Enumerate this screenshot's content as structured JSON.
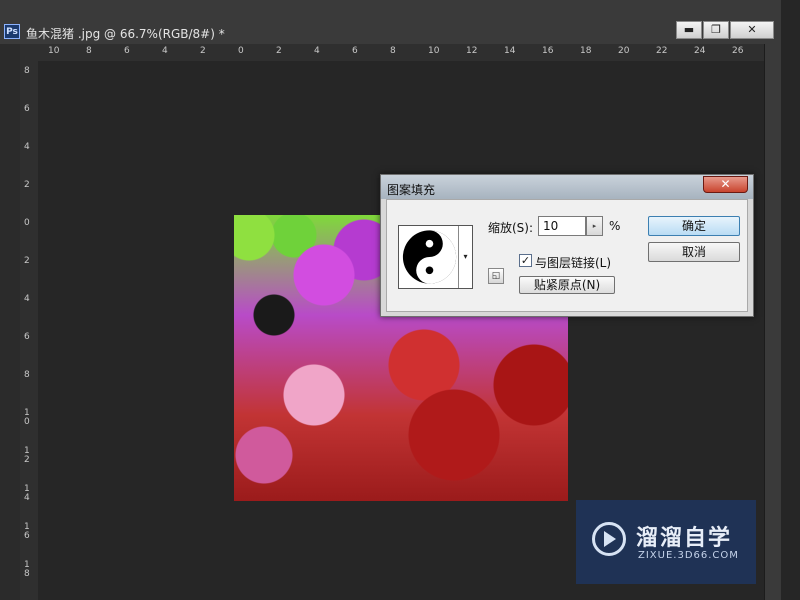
{
  "document": {
    "app_icon_label": "Ps",
    "title": "鱼木混猪 .jpg @ 66.7%(RGB/8#) *",
    "window_buttons": [
      "▬",
      "❐",
      "✕"
    ]
  },
  "rulers": {
    "top": [
      "10",
      "8",
      "6",
      "4",
      "2",
      "0",
      "2",
      "4",
      "6",
      "8",
      "10",
      "12",
      "14",
      "16",
      "18",
      "20",
      "22",
      "24",
      "26"
    ],
    "left": [
      "8",
      "6",
      "4",
      "2",
      "0",
      "2",
      "4",
      "6",
      "8",
      "10",
      "12",
      "14",
      "16",
      "18"
    ]
  },
  "dialog": {
    "title": "图案填充",
    "close_label": "✕",
    "scale_label": "缩放(S):",
    "scale_value": "10",
    "scale_unit": "%",
    "spin_label": "▸",
    "link_checked": true,
    "link_check_mark": "✓",
    "link_label": "与图层链接(L)",
    "snap_origin_label": "贴紧原点(N)",
    "ok_label": "确定",
    "cancel_label": "取消",
    "pattern_arrow": "▾",
    "small_button_label": "◱"
  },
  "watermark": {
    "name": "溜溜自学",
    "url": "ZIXUE.3D66.COM"
  }
}
